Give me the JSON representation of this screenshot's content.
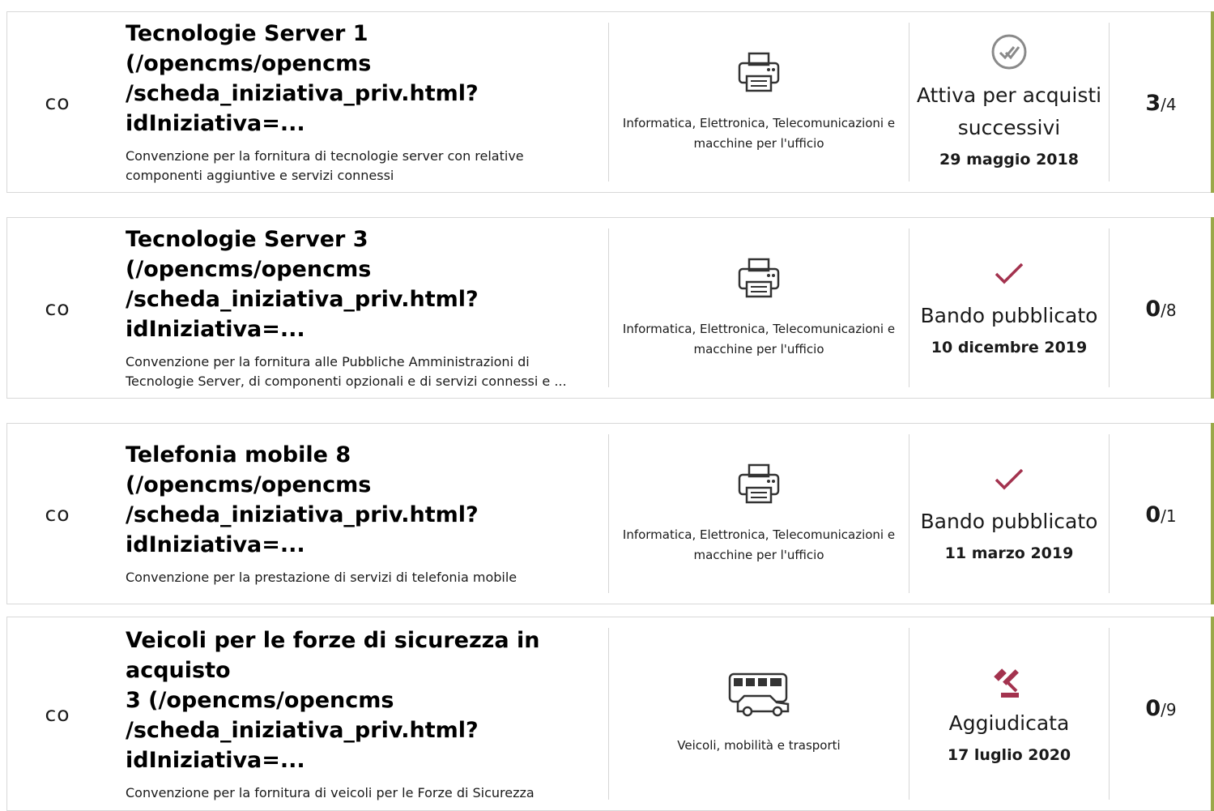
{
  "rows": [
    {
      "type": "CO",
      "title": "Tecnologie Server 1 (/opencms/opencms/scheda_iniziativa_priv.html?idIniziativa=...",
      "title_line1": "Tecnologie Server 1 (/opencms/opencms",
      "title_line2": "/scheda_iniziativa_priv.html?idIniziativa=...",
      "description": "Convenzione per la fornitura di tecnologie server con relative componenti aggiuntive e servizi connessi",
      "category_icon": "printer-icon",
      "category": "Informatica, Elettronica, Telecomunicazioni e macchine per l'ufficio",
      "status_icon": "double-check-circle-icon",
      "status": "Attiva per acquisti successivi",
      "date": "29 maggio 2018",
      "count_num": "3",
      "count_total": "/4"
    },
    {
      "type": "CO",
      "title_line1": "Tecnologie Server 3 (/opencms/opencms",
      "title_line2": "/scheda_iniziativa_priv.html?idIniziativa=...",
      "description": "Convenzione per la fornitura alle Pubbliche Amministrazioni di Tecnologie Server, di componenti opzionali e di servizi connessi e ...",
      "category_icon": "printer-icon",
      "category": "Informatica, Elettronica, Telecomunicazioni e macchine per l'ufficio",
      "status_icon": "checkmark-icon",
      "status": "Bando pubblicato",
      "date": "10 dicembre 2019",
      "count_num": "0",
      "count_total": "/8"
    },
    {
      "type": "CO",
      "title_line1": "Telefonia mobile 8 (/opencms/opencms",
      "title_line2": "/scheda_iniziativa_priv.html?idIniziativa=...",
      "description": "Convenzione per la prestazione di servizi di telefonia mobile",
      "category_icon": "printer-icon",
      "category": "Informatica, Elettronica, Telecomunicazioni e macchine per l'ufficio",
      "status_icon": "checkmark-icon",
      "status": "Bando pubblicato",
      "date": "11 marzo 2019",
      "count_num": "0",
      "count_total": "/1"
    },
    {
      "type": "CO",
      "title_line1": "Veicoli per le forze di sicurezza in acquisto",
      "title_line2": "3 (/opencms/opencms",
      "title_line3": "/scheda_iniziativa_priv.html?idIniziativa=...",
      "description": "Convenzione per la fornitura di veicoli per le Forze di Sicurezza",
      "category_icon": "vehicles-icon",
      "category": "Veicoli, mobilità e trasporti",
      "status_icon": "gavel-icon",
      "status": "Aggiudicata",
      "date": "17 luglio 2020",
      "count_num": "0",
      "count_total": "/9"
    }
  ],
  "colors": {
    "accent": "#9aa84a",
    "status_icon": "#a3324e",
    "grey_icon": "#8a8a8a",
    "border": "#d8d8d8"
  }
}
